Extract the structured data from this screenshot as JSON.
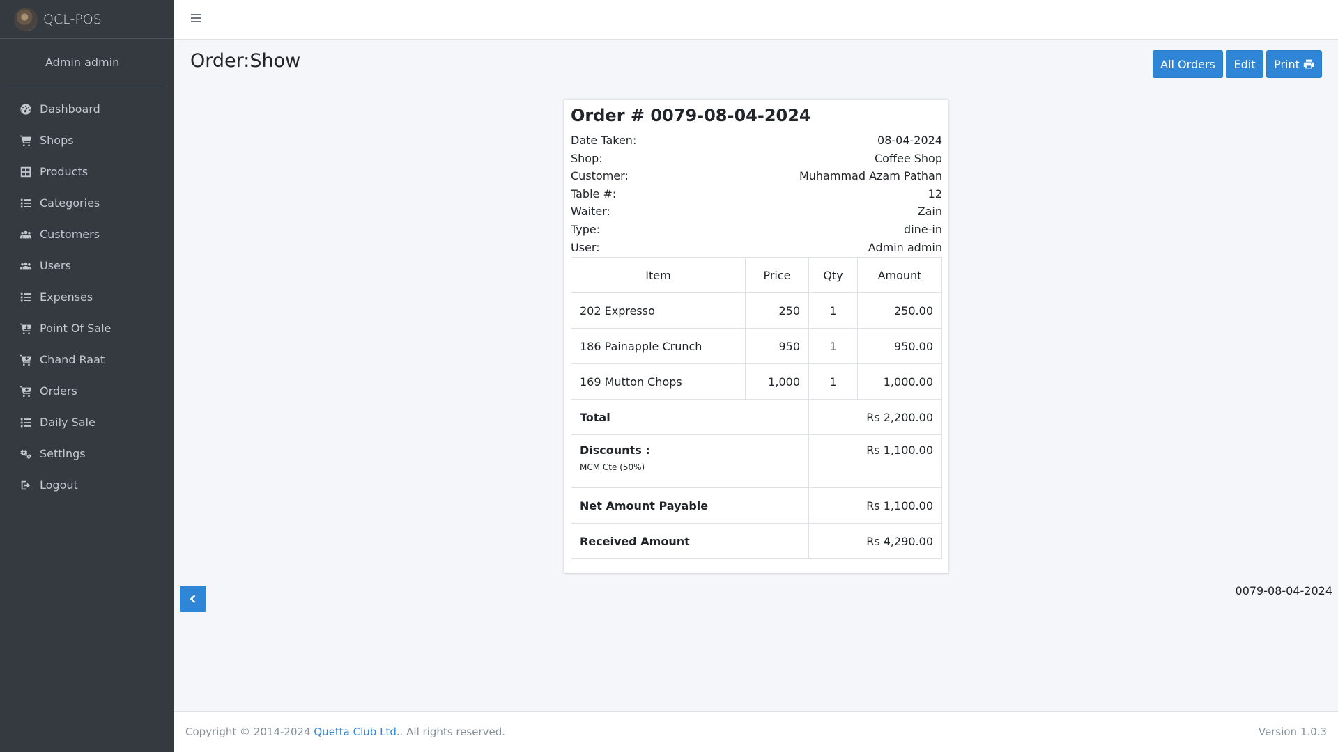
{
  "app": {
    "brand": "QCL-POS",
    "user": "Admin admin"
  },
  "sidebar": {
    "items": [
      {
        "label": "Dashboard",
        "icon": "dashboard-icon"
      },
      {
        "label": "Shops",
        "icon": "cart-icon"
      },
      {
        "label": "Products",
        "icon": "grid-icon"
      },
      {
        "label": "Categories",
        "icon": "list-icon"
      },
      {
        "label": "Customers",
        "icon": "users-icon"
      },
      {
        "label": "Users",
        "icon": "users-icon"
      },
      {
        "label": "Expenses",
        "icon": "list-icon"
      },
      {
        "label": "Point Of Sale",
        "icon": "cart-plus-icon"
      },
      {
        "label": "Chand Raat",
        "icon": "cart-plus-icon"
      },
      {
        "label": "Orders",
        "icon": "cart-plus-icon"
      },
      {
        "label": "Daily Sale",
        "icon": "list-icon"
      },
      {
        "label": "Settings",
        "icon": "cogs-icon"
      },
      {
        "label": "Logout",
        "icon": "sign-out-icon"
      }
    ]
  },
  "header": {
    "title": "Order:Show",
    "buttons": {
      "all_orders": "All Orders",
      "edit": "Edit",
      "print": "Print"
    }
  },
  "order": {
    "title": "Order # 0079-08-04-2024",
    "info": [
      {
        "label": "Date Taken:",
        "value": "08-04-2024"
      },
      {
        "label": "Shop:",
        "value": "Coffee Shop"
      },
      {
        "label": "Customer:",
        "value": "Muhammad Azam Pathan"
      },
      {
        "label": "Table #:",
        "value": "12"
      },
      {
        "label": "Waiter:",
        "value": "Zain"
      },
      {
        "label": "Type:",
        "value": "dine-in"
      },
      {
        "label": "User:",
        "value": "Admin admin"
      }
    ],
    "columns": {
      "item": "Item",
      "price": "Price",
      "qty": "Qty",
      "amount": "Amount"
    },
    "items": [
      {
        "item": "202 Expresso",
        "price": "250",
        "qty": "1",
        "amount": "250.00"
      },
      {
        "item": "186 Painapple Crunch",
        "price": "950",
        "qty": "1",
        "amount": "950.00"
      },
      {
        "item": "169 Mutton Chops",
        "price": "1,000",
        "qty": "1",
        "amount": "1,000.00"
      }
    ],
    "total_label": "Total",
    "total_value": "Rs 2,200.00",
    "discount_label": "Discounts :",
    "discount_detail": "MCM Cte (50%)",
    "discount_value": "Rs 1,100.00",
    "net_label": "Net Amount Payable",
    "net_value": "Rs 1,100.00",
    "received_label": "Received Amount",
    "received_value": "Rs 4,290.00"
  },
  "reference": "0079-08-04-2024",
  "footer": {
    "copyright_prefix": "Copyright © 2014-2024",
    "company": "Quetta Club Ltd.",
    "rights": ". All rights reserved.",
    "version": "Version 1.0.3"
  },
  "colors": {
    "sidebar_bg": "#343a40",
    "primary": "#2f86d6",
    "page_bg": "#f4f6f9"
  }
}
